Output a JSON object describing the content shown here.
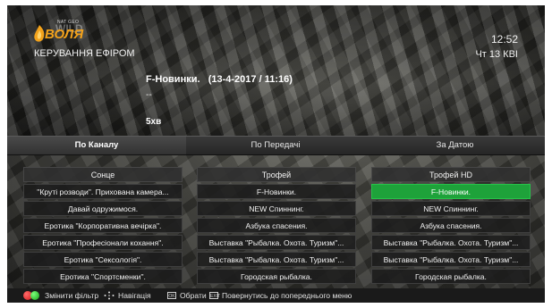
{
  "header": {
    "logo_top_text": "NAT GEO",
    "logo_background_text": "WILD",
    "logo_text": "ВОЛЯ",
    "title": "КЕРУВАННЯ ЕФІРОМ",
    "clock": "12:52",
    "date": "Чт 13 КВІ"
  },
  "program": {
    "title": "F-Новинки.   (13-4-2017 / 11:16)",
    "description": "--",
    "duration": "5хв"
  },
  "tabs": [
    {
      "label": "По Каналу"
    },
    {
      "label": "По Передачі"
    },
    {
      "label": "За Датою"
    }
  ],
  "columns": [
    {
      "header": "Сонце",
      "items": [
        "\"Круті розводи\". Прихована камера...",
        "Давай одружимося.",
        "Еротика \"Корпоративна вечірка\".",
        "Еротика \"Професіонали кохання\".",
        "Еротика \"Сексологія\".",
        "Еротика \"Спортсменки\"."
      ]
    },
    {
      "header": "Трофей",
      "items": [
        "F-Новинки.",
        "NEW Спиннинг.",
        "Азбука спасения.",
        "Выставка \"Рыбалка. Охота. Туризм\"...",
        "Выставка \"Рыбалка. Охота. Туризм\"...",
        "Городская рыбалка."
      ]
    },
    {
      "header": "Трофей HD",
      "items": [
        "F-Новинки.",
        "NEW Спиннинг.",
        "Азбука спасения.",
        "Выставка \"Рыбалка. Охота. Туризм\"...",
        "Выставка \"Рыбалка. Охота. Туризм\"...",
        "Городская рыбалка."
      ]
    }
  ],
  "selected": {
    "column": 2,
    "row": 0
  },
  "footer": {
    "filter_label": "Змінити фільтр",
    "navigation_label": "Навігація",
    "ok_key": "OK",
    "select_label": "Обрати",
    "back_key": "EXIT",
    "back_label": "Повернутись до попереднього меню"
  },
  "colors": {
    "selected": "#1ea23a",
    "logo_accent": "#f3a21b",
    "red_button": "#d11a1a",
    "green_button": "#16a016"
  },
  "icons": [
    "red-button-icon",
    "green-button-icon",
    "navigation-arrows-icon",
    "ok-key-icon",
    "exit-key-icon"
  ]
}
